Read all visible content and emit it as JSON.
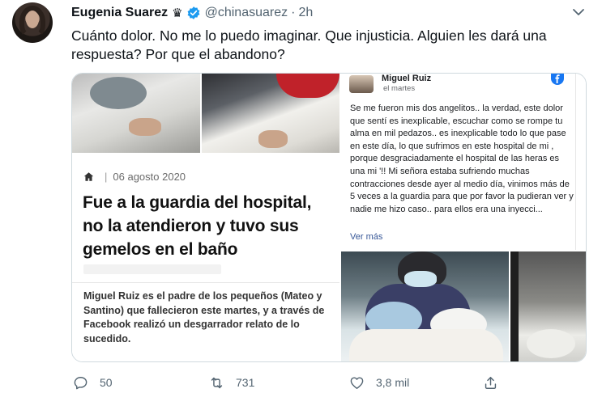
{
  "tweet": {
    "display_name": "Eugenia Suarez",
    "crown": "♛",
    "handle": "@chinasuarez",
    "dot": "·",
    "time": "2h",
    "text": "Cuánto dolor. No me lo puedo imaginar. Que injusticia. Alguien les dará una respuesta? Por que el abandono?",
    "verified_color": "#1d9bf0"
  },
  "media": {
    "article": {
      "date": "06 agosto 2020",
      "separator": "|",
      "title": "Fue a la guardia del hospital, no la atendieron y tuvo sus gemelos en el baño",
      "summary": "Miguel Ruiz es el padre de los pequeños (Mateo y Santino) que fallecieron este martes, y a través de Facebook realizó un desgarrador relato de lo sucedido."
    },
    "facebook_post": {
      "author": "Miguel Ruiz",
      "date": "el martes",
      "text": "Se me fueron mis dos angelitos.. la verdad, este dolor que sentí es inexplicable, escuchar como se rompe tu alma en mil pedazos.. es inexplicable todo lo que pase en este día, lo que sufrimos en este hospital de mi     , porque desgraciadamente el hospital de las heras es una mi      '!! Mi señora estaba sufriendo muchas contracciones desde ayer al medio día, vinimos más de 5 veces a la guardia para que por favor la pudieran ver y nadie me hizo caso.. para ellos era una inyecci...",
      "see_more": "Ver más",
      "brand_color": "#1877f2"
    }
  },
  "actions": {
    "reply_count": "50",
    "retweet_count": "731",
    "like_count": "3,8 mil",
    "icon_color": "#536471"
  }
}
